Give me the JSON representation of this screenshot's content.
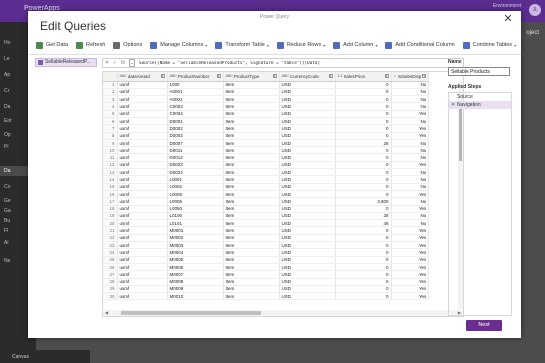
{
  "background": {
    "app_name": "PowerApps",
    "environment_label": "Environment",
    "environment_value": "...",
    "avatar_initials": "JL",
    "project_text": "oject",
    "nav_items": [
      "Ho",
      "Le",
      "Ap",
      "Cr",
      "Da",
      "Ent",
      "Op",
      "Pi",
      "Da",
      "Co",
      "Ge",
      "Ga",
      "Bu",
      "Fl",
      "Ai",
      "Ne"
    ],
    "bottom_label": "Canvas"
  },
  "dialog": {
    "subtitle": "Power Query",
    "title": "Edit Queries",
    "close_glyph": "✕",
    "toolbar": [
      {
        "label": "Get Data",
        "icon": "get-data-icon",
        "caret": false
      },
      {
        "label": "Refresh",
        "icon": "refresh-icon",
        "caret": false
      },
      {
        "label": "Options",
        "icon": "options-icon",
        "caret": false
      },
      {
        "label": "Manage Columns",
        "icon": "manage-columns-icon",
        "caret": true
      },
      {
        "label": "Transform Table",
        "icon": "transform-table-icon",
        "caret": true
      },
      {
        "label": "Reduce Rows",
        "icon": "reduce-rows-icon",
        "caret": true
      },
      {
        "label": "Add Column",
        "icon": "add-column-icon",
        "caret": true
      },
      {
        "label": "Add Conditional Column",
        "icon": "conditional-column-icon",
        "caret": false
      },
      {
        "label": "Combine Tables",
        "icon": "combine-tables-icon",
        "caret": true
      }
    ],
    "queries": [
      {
        "label": "SellableReleasedP..."
      }
    ],
    "formula": {
      "cancel": "✕",
      "accept": "✓",
      "fx": "fx",
      "text": "Source{[Name = \"SellableReleasedProducts\", Signature = \"table\"]}[Data]"
    },
    "grid": {
      "columns": [
        {
          "name": "",
          "type": ""
        },
        {
          "name": "dataAreaId",
          "type": "ABC"
        },
        {
          "name": "ProductNumber",
          "type": "ABC"
        },
        {
          "name": "ProductType",
          "type": "ABC"
        },
        {
          "name": "CurrencyCode",
          "type": "ABC"
        },
        {
          "name": "SalesPrice",
          "type": "1.2"
        },
        {
          "name": "IsSalesDisp",
          "type": "✓"
        }
      ],
      "rows": [
        [
          "1",
          "usmf",
          "1000",
          "Item",
          "USD",
          "0",
          "No"
        ],
        [
          "2",
          "usmf",
          "A0001",
          "Item",
          "USD",
          "0",
          "No"
        ],
        [
          "3",
          "usmf",
          "A0002",
          "Item",
          "USD",
          "0",
          "No"
        ],
        [
          "4",
          "usmf",
          "C0002",
          "Item",
          "USD",
          "0",
          "No"
        ],
        [
          "5",
          "usmf",
          "C0004",
          "Item",
          "USD",
          "0",
          "Yes"
        ],
        [
          "6",
          "usmf",
          "D0001",
          "Item",
          "USD",
          "0",
          "No"
        ],
        [
          "7",
          "usmf",
          "D0002",
          "Item",
          "USD",
          "0",
          "Yes"
        ],
        [
          "8",
          "usmf",
          "D0003",
          "Item",
          "USD",
          "0",
          "Yes"
        ],
        [
          "9",
          "usmf",
          "D0007",
          "Item",
          "USD",
          "28",
          "No"
        ],
        [
          "10",
          "usmf",
          "D0011",
          "Item",
          "USD",
          "0",
          "No"
        ],
        [
          "11",
          "usmf",
          "D0012",
          "Item",
          "USD",
          "0",
          "No"
        ],
        [
          "12",
          "usmf",
          "D0023",
          "Item",
          "USD",
          "0",
          "Yes"
        ],
        [
          "13",
          "usmf",
          "D0024",
          "Item",
          "USD",
          "0",
          "No"
        ],
        [
          "14",
          "usmf",
          "L0001",
          "Item",
          "USD",
          "0",
          "No"
        ],
        [
          "15",
          "usmf",
          "L0002",
          "Item",
          "USD",
          "0",
          "No"
        ],
        [
          "16",
          "usmf",
          "L0005",
          "Item",
          "USD",
          "0",
          "Yes"
        ],
        [
          "17",
          "usmf",
          "L0006",
          "Item",
          "USD",
          "3,800",
          "No"
        ],
        [
          "18",
          "usmf",
          "L0050",
          "Item",
          "USD",
          "0",
          "Yes"
        ],
        [
          "19",
          "usmf",
          "L0100",
          "Item",
          "USD",
          "28",
          "No"
        ],
        [
          "20",
          "usmf",
          "L0101",
          "Item",
          "USD",
          "48",
          "No"
        ],
        [
          "21",
          "usmf",
          "M0001",
          "Item",
          "USD",
          "0",
          "Yes"
        ],
        [
          "22",
          "usmf",
          "M0002",
          "Item",
          "USD",
          "0",
          "Yes"
        ],
        [
          "23",
          "usmf",
          "M0003",
          "Item",
          "USD",
          "0",
          "Yes"
        ],
        [
          "24",
          "usmf",
          "M0004",
          "Item",
          "USD",
          "0",
          "Yes"
        ],
        [
          "25",
          "usmf",
          "M0005",
          "Item",
          "USD",
          "0",
          "Yes"
        ],
        [
          "26",
          "usmf",
          "M0006",
          "Item",
          "USD",
          "0",
          "Yes"
        ],
        [
          "27",
          "usmf",
          "M0007",
          "Item",
          "USD",
          "0",
          "Yes"
        ],
        [
          "28",
          "usmf",
          "M0008",
          "Item",
          "USD",
          "0",
          "Yes"
        ],
        [
          "29",
          "usmf",
          "M0009",
          "Item",
          "USD",
          "0",
          "Yes"
        ],
        [
          "30",
          "usmf",
          "M0010",
          "Item",
          "USD",
          "0",
          "Yes"
        ]
      ]
    },
    "properties": {
      "name_label": "Name",
      "name_value": "Sellable Products",
      "applied_steps_label": "Applied Steps",
      "steps": [
        {
          "label": "Source",
          "selected": false,
          "removable": false
        },
        {
          "label": "Navigation",
          "selected": true,
          "removable": true
        }
      ]
    },
    "next_label": "Next"
  },
  "colors": {
    "accent": "#6b2e8e",
    "selection": "#e8e0f1",
    "topbar": "#5c2d91"
  }
}
